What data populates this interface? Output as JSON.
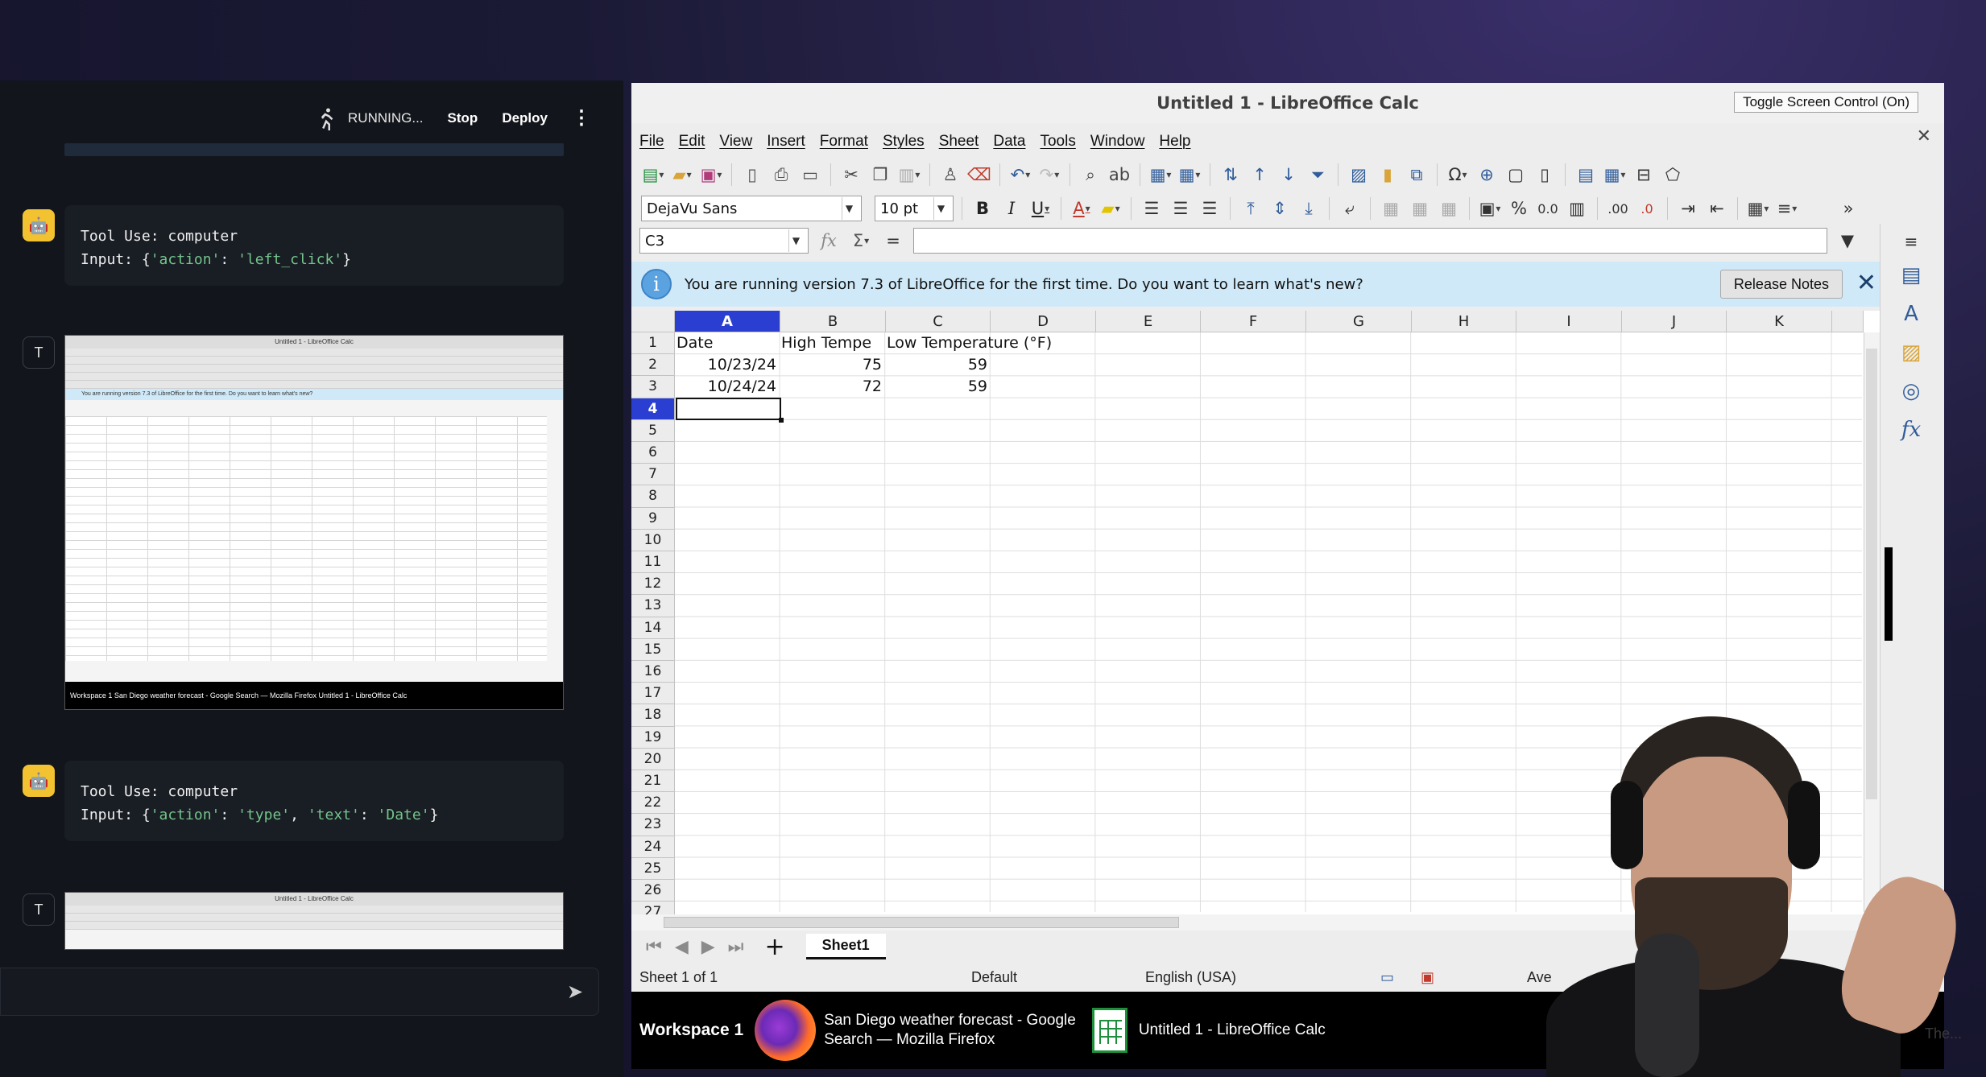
{
  "left_panel": {
    "status": "RUNNING...",
    "stop_label": "Stop",
    "deploy_label": "Deploy",
    "messages": [
      {
        "role_icon": "robot-icon",
        "title": "Tool Use: computer",
        "input_prefix": "Input: {",
        "input_key1": "'action'",
        "colon1": ": ",
        "input_val1": "'left_click'",
        "suffix": "}"
      },
      {
        "role_icon": "T",
        "screenshot_title": "Untitled 1 - LibreOffice Calc",
        "screenshot_info": "You are running version 7.3 of LibreOffice for the first time. Do you want to learn what's new?",
        "screenshot_taskbar": "Workspace 1   San Diego weather forecast - Google Search — Mozilla Firefox      Untitled 1 - LibreOffice Calc"
      },
      {
        "role_icon": "robot-icon",
        "title": "Tool Use: computer",
        "input_prefix": "Input: {",
        "input_key1": "'action'",
        "colon1": ": ",
        "input_val1": "'type'",
        "comma": ", ",
        "input_key2": "'text'",
        "colon2": ": ",
        "input_val2": "'Date'",
        "suffix": "}"
      },
      {
        "role_icon": "T",
        "screenshot_title": "Untitled 1 - LibreOffice Calc"
      }
    ]
  },
  "vm": {
    "window_title": "Untitled 1 - LibreOffice Calc",
    "toggle_label": "Toggle Screen Control (On)",
    "menu": [
      "File",
      "Edit",
      "View",
      "Insert",
      "Format",
      "Styles",
      "Sheet",
      "Data",
      "Tools",
      "Window",
      "Help"
    ],
    "font_name": "DejaVu Sans",
    "font_size": "10 pt",
    "name_box": "C3",
    "infobar_text": "You are running version 7.3 of LibreOffice for the first time. Do you want to learn what's new?",
    "release_notes": "Release Notes",
    "columns": [
      "A",
      "B",
      "C",
      "D",
      "E",
      "F",
      "G",
      "H",
      "I",
      "J",
      "K"
    ],
    "rows": [
      "1",
      "2",
      "3",
      "4",
      "5",
      "6",
      "7",
      "8",
      "9",
      "10",
      "11",
      "12",
      "13",
      "14",
      "15",
      "16",
      "17",
      "18",
      "19",
      "20",
      "21",
      "22",
      "23",
      "24",
      "25",
      "26",
      "27"
    ],
    "cells": {
      "A1": "Date",
      "B1": "High Tempe",
      "C1": "Low Temperature (°F)",
      "A2": "10/23/24",
      "B2": "75",
      "C2": "59",
      "A3": "10/24/24",
      "B3": "72",
      "C3": "59"
    },
    "sheet_tab": "Sheet1",
    "status": {
      "sheet": "Sheet 1 of 1",
      "style": "Default",
      "language": "English (USA)",
      "avg": "Ave"
    },
    "taskbar": {
      "workspace": "Workspace 1",
      "firefox_line1": "San Diego weather forecast - Google",
      "firefox_line2": "Search — Mozilla Firefox",
      "calc": "Untitled 1 - LibreOffice Calc"
    }
  },
  "watermark": "The...",
  "colors": {
    "accent": "#2a3fd2",
    "info_bar": "#cfe9f8",
    "chat_bg": "#12151b",
    "badge": "#f2c230"
  }
}
